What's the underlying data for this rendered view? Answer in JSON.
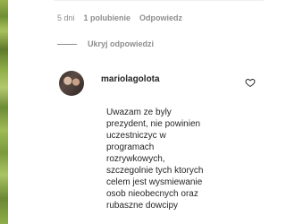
{
  "meta": {
    "time": "5 dni",
    "likes": "1 polubienie",
    "reply": "Odpowiedz"
  },
  "replies_toggle": {
    "label": "Ukryj odpowiedzi"
  },
  "comment": {
    "username": "mariolagolota",
    "text": "Uwazam ze byly\nprezydent, nie powinien\nuczestniczyc w\nprogramach\nrozrywkowych,\nszczegolnie tych ktorych\ncelem jest wysmiewanie\nosob nieobecnych oraz\nrubaszne dowcipy"
  },
  "icons": {
    "like": "heart-outline-icon",
    "avatar": "user-avatar"
  }
}
